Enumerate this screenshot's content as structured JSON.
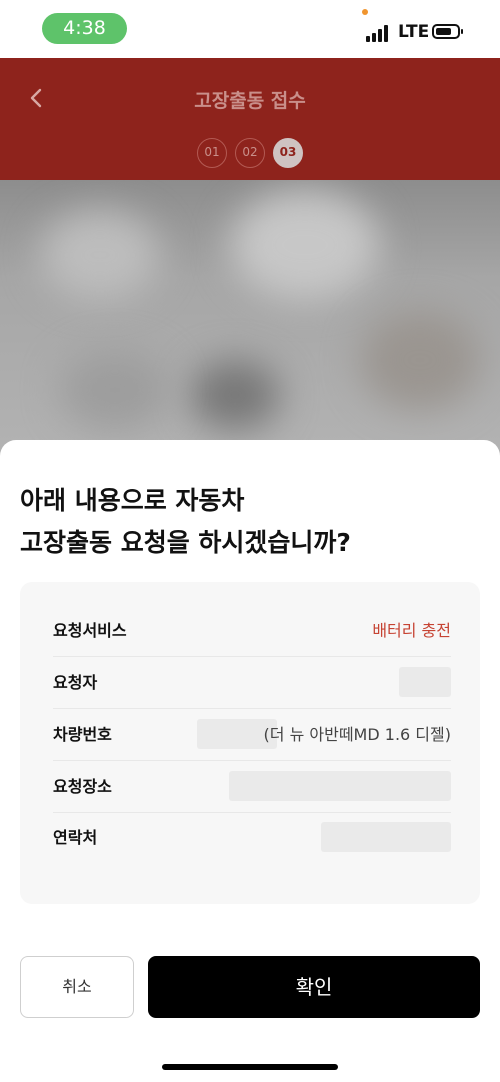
{
  "status_bar": {
    "time": "4:38",
    "network": "LTE"
  },
  "header": {
    "title": "고장출동 접수",
    "steps": [
      "01",
      "02",
      "03"
    ],
    "active_step": "03"
  },
  "sheet": {
    "title_line1": "아래 내용으로 자동차",
    "title_line2": "고장출동 요청을 하시겠습니까?",
    "rows": [
      {
        "label": "요청서비스",
        "value": "배터리 충전"
      },
      {
        "label": "요청자",
        "value": ""
      },
      {
        "label": "차량번호",
        "value": "(더 뉴 아반떼MD 1.6 디젤)"
      },
      {
        "label": "요청장소",
        "value": ""
      },
      {
        "label": "연락처",
        "value": ""
      }
    ],
    "cancel_label": "취소",
    "confirm_label": "확인"
  },
  "colors": {
    "header_bg": "#8e231c",
    "accent_red": "#c64333",
    "confirm_bg": "#000000",
    "time_pill": "#5ec36a"
  }
}
